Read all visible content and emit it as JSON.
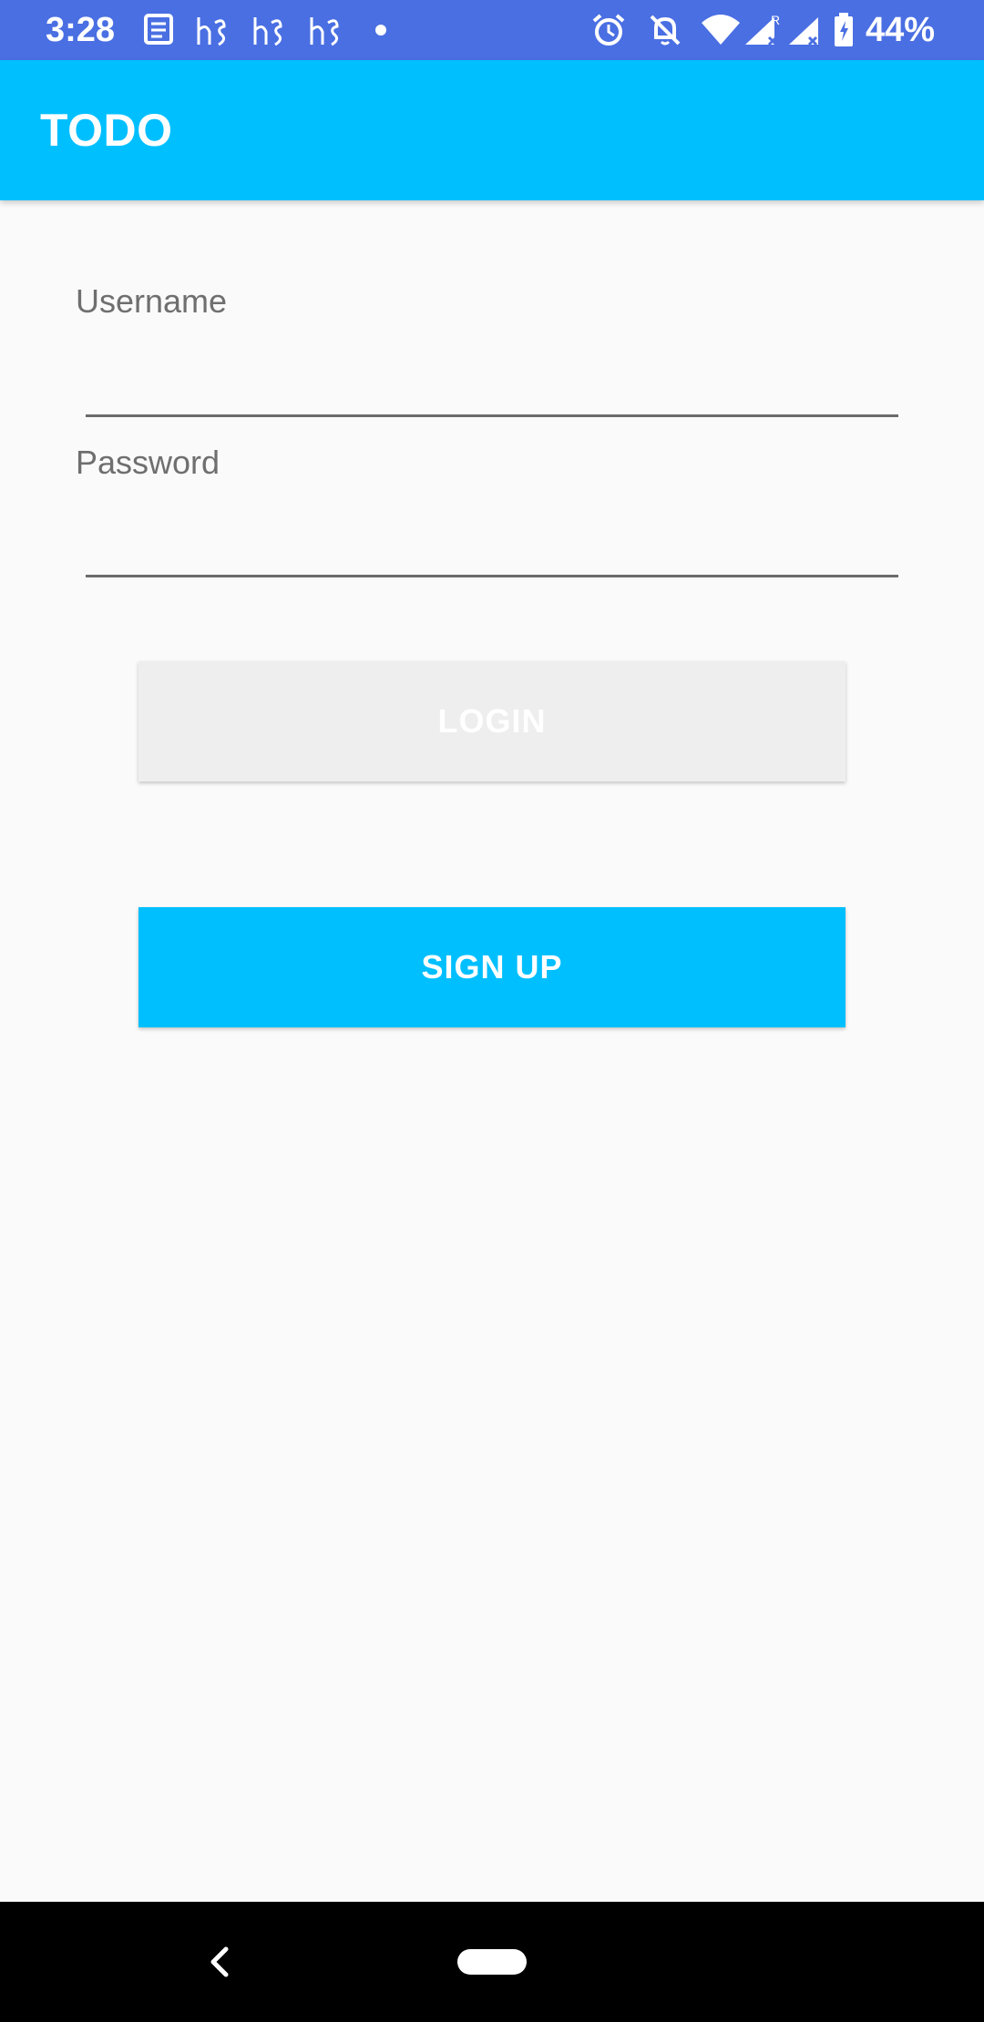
{
  "status_bar": {
    "time": "3:28",
    "battery_percent": "44%",
    "icons": [
      "news-icon",
      "hs-app-icon",
      "hs-app-icon",
      "hs-app-icon",
      "dot-icon",
      "alarm-icon",
      "notifications-off-icon",
      "wifi-icon",
      "cell-signal-roaming-icon",
      "cell-signal-icon",
      "battery-charging-icon"
    ],
    "color": "#4a6fe3"
  },
  "app_bar": {
    "title": "TODO",
    "color": "#00bfff"
  },
  "form": {
    "username_label": "Username",
    "username_value": "",
    "password_label": "Password",
    "password_value": ""
  },
  "buttons": {
    "login_label": "LOGIN",
    "signup_label": "SIGN UP",
    "login_color": "#eeeeee",
    "signup_color": "#00bfff"
  },
  "nav_bar": {
    "icons": [
      "back-icon",
      "home-pill-icon"
    ]
  }
}
